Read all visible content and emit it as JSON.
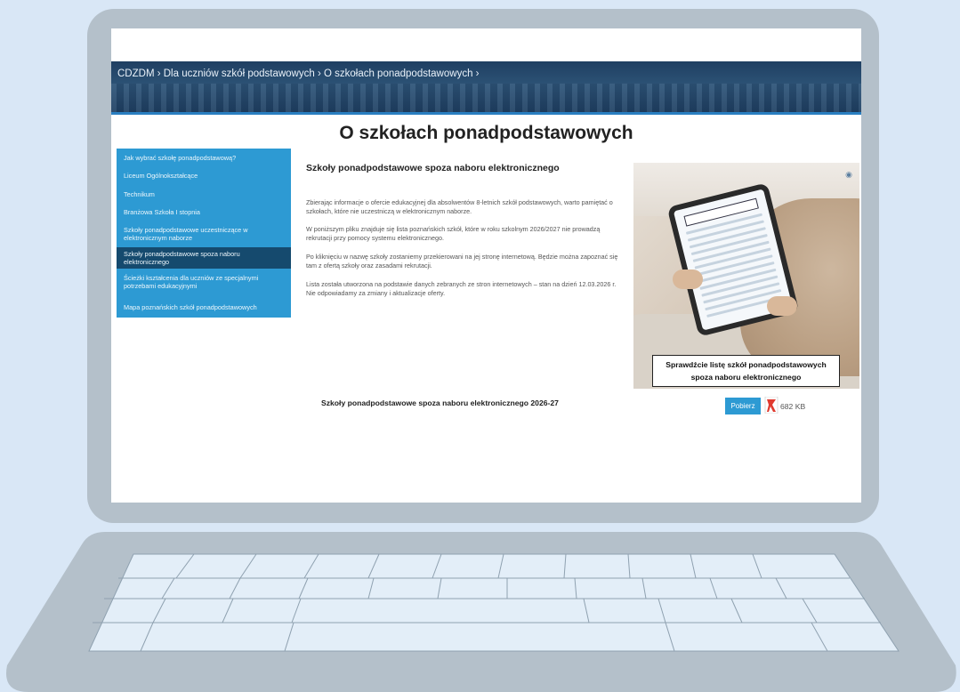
{
  "breadcrumb": "CDZDM › Dla uczniów szkół podstawowych › O szkołach ponadpodstawowych ›",
  "page_title": "O szkołach ponadpodstawowych",
  "sidebar": {
    "items": [
      {
        "label": "Jak wybrać szkołę ponadpodstawową?"
      },
      {
        "label": "Liceum Ogólnokształcące"
      },
      {
        "label": "Technikum"
      },
      {
        "label": "Branżowa Szkoła I stopnia"
      },
      {
        "label": "Szkoły ponadpodstawowe uczestniczące w elektronicznym naborze"
      },
      {
        "label": "Szkoły ponadpodstawowe spoza naboru elektronicznego"
      },
      {
        "label": "Ścieżki kształcenia dla uczniów ze specjalnymi potrzebami edukacyjnymi"
      },
      {
        "label": "Mapa poznańskich szkół ponadpodstawowych"
      }
    ]
  },
  "content": {
    "heading": "Szkoły ponadpodstawowe spoza naboru elektronicznego",
    "paragraphs": [
      "Zbierając informacje o ofercie edukacyjnej dla absolwentów 8-letnich szkół podstawowych, warto pamiętać o szkołach, które nie uczestniczą w elektronicznym naborze.",
      "W poniższym pliku znajduje się lista poznańskich szkół, które w roku szkolnym 2026/2027 nie prowadzą rekrutacji przy pomocy systemu elektronicznego.",
      "Po kliknięciu w nazwę szkoły zostaniemy przekierowani na jej stronę internetową. Będzie można zapoznać się tam z ofertą szkoły oraz zasadami rekrutacji.",
      "Lista została utworzona na podstawie danych zebranych ze stron internetowych – stan na dzień 12.03.2026 r. Nie odpowiadamy za zmiany i aktualizacje oferty."
    ]
  },
  "promo": {
    "caption_line1": "Sprawdźcie listę szkół ponadpodstawowych",
    "caption_line2": "spoza naboru elektronicznego"
  },
  "download": {
    "title": "Szkoły ponadpodstawowe spoza naboru elektronicznego 2026-27",
    "button_label": "Pobierz",
    "file_size": "682 KB",
    "file_icon": "pdf-icon"
  },
  "colors": {
    "background": "#d9e7f6",
    "laptop_frame": "#b4c0ca",
    "sidebar": "#2d9ad3",
    "sidebar_active": "#154a6e",
    "banner": "#1f3f62"
  }
}
